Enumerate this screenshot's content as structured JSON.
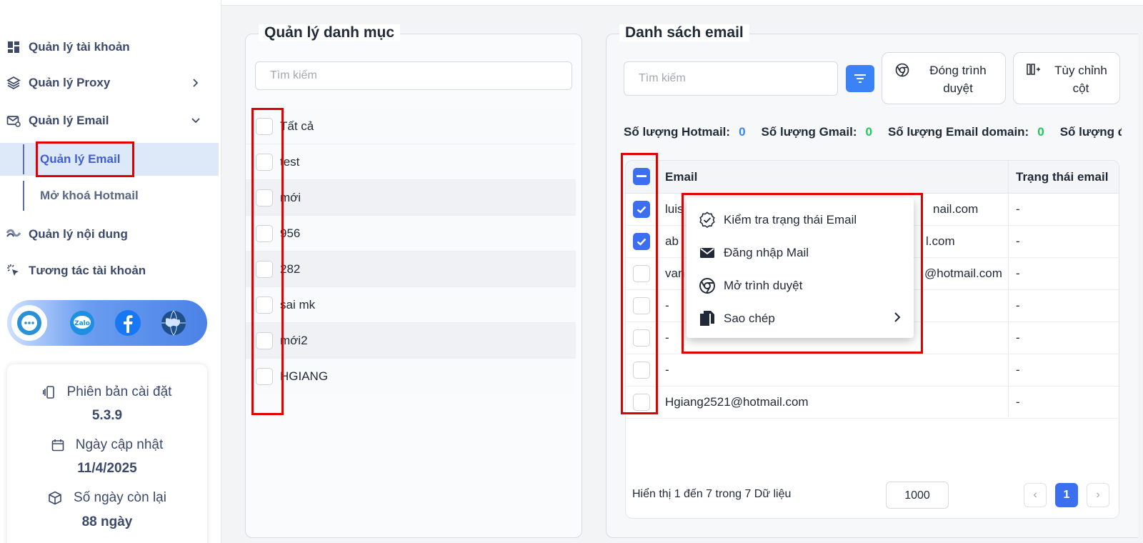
{
  "sidebar": {
    "items": [
      {
        "label": "Quản lý tài khoản",
        "icon": "dashboard-icon"
      },
      {
        "label": "Quản lý Proxy",
        "icon": "layers-icon"
      },
      {
        "label": "Quản lý Email",
        "icon": "mail-settings-icon"
      },
      {
        "label": "Quản lý nội dung",
        "icon": "content-icon"
      },
      {
        "label": "Tương tác tài khoản",
        "icon": "click-icon"
      }
    ],
    "email_sub": [
      {
        "label": "Quản lý Email",
        "active": true
      },
      {
        "label": "Mở khoá Hotmail",
        "active": false
      }
    ],
    "social": [
      "support-icon",
      "zalo-icon",
      "facebook-icon",
      "globe-icon"
    ],
    "social_zalo_text": "Zalo",
    "info": {
      "version_label": "Phiên bản cài đặt",
      "version_value": "5.3.9",
      "update_label": "Ngày cập nhật",
      "update_value": "11/4/2025",
      "remain_label": "Số ngày còn lại",
      "remain_value": "88 ngày"
    }
  },
  "categories": {
    "title": "Quản lý danh mục",
    "search_placeholder": "Tìm kiếm",
    "items": [
      "Tất cả",
      "test",
      "mới",
      "956",
      "282",
      "sai mk",
      "mới2",
      "HGIANG"
    ]
  },
  "emails": {
    "title": "Danh sách email",
    "search_placeholder": "Tìm kiếm",
    "close_browser_label": "Đóng trình duyệt",
    "customize_columns_label": "Tùy chỉnh cột",
    "counts": [
      {
        "label": "Số lượng Hotmail:",
        "value": "0",
        "color": "#3b82f6"
      },
      {
        "label": "Số lượng Gmail:",
        "value": "0",
        "color": "#22c55e"
      },
      {
        "label": "Số lượng Email domain:",
        "value": "0",
        "color": "#22c55e"
      },
      {
        "label": "Số lượng đã",
        "value": "",
        "color": "#22c55e"
      }
    ],
    "columns": [
      "Email",
      "Trạng thái email"
    ],
    "rows": [
      {
        "email_left": "luis",
        "email_right": "nail.com",
        "status": "-",
        "checked": true
      },
      {
        "email_left": "ab",
        "email_right": "l.com",
        "status": "-",
        "checked": true
      },
      {
        "email_left": "van",
        "email_right": "@hotmail.com",
        "status": "-",
        "checked": false
      },
      {
        "email_left": "-",
        "email_right": "",
        "status": "-",
        "checked": false
      },
      {
        "email_left": "-",
        "email_right": "",
        "status": "-",
        "checked": false
      },
      {
        "email_left": "-",
        "email_right": "",
        "status": "-",
        "checked": false
      },
      {
        "email_left": "Hgiang2521@hotmail.com",
        "email_right": "",
        "status": "-",
        "checked": false
      }
    ],
    "footer_text": "Hiển thị 1 đến 7 trong 7 Dữ liệu",
    "page_size": "1000",
    "current_page": "1",
    "prev_symbol": "‹",
    "next_symbol": "›"
  },
  "context_menu": {
    "items": [
      {
        "label": "Kiểm tra trạng thái Email",
        "icon": "verified-badge-icon"
      },
      {
        "label": "Đăng nhập Mail",
        "icon": "mail-icon"
      },
      {
        "label": "Mở trình duyệt",
        "icon": "chrome-icon"
      },
      {
        "label": "Sao chép",
        "icon": "copy-icon",
        "submenu": true
      }
    ],
    "submenu_symbol": "›"
  },
  "colors": {
    "accent": "#3b6ff0",
    "highlight_box": "#e10000"
  }
}
